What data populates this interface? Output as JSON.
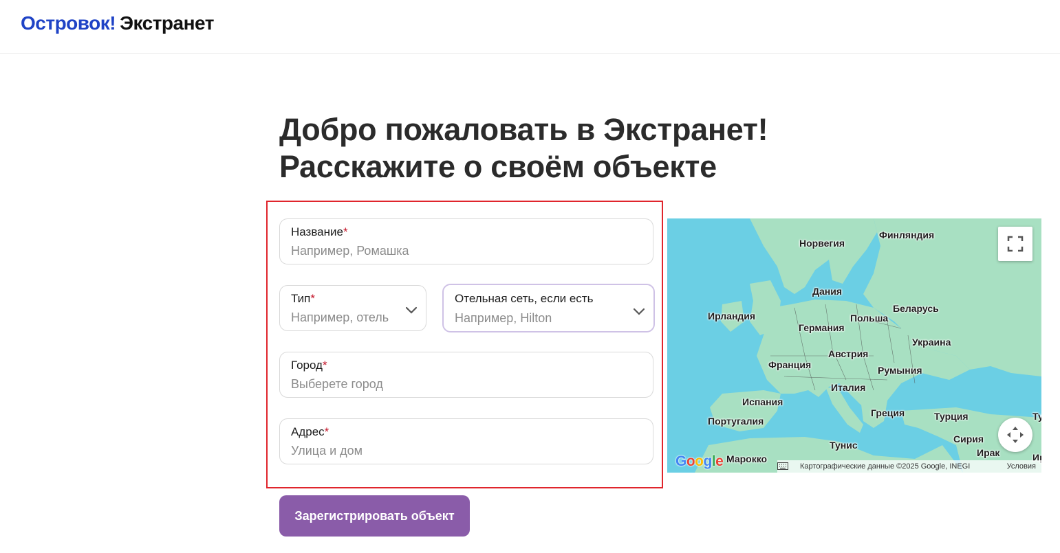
{
  "header": {
    "brand": "Островок!",
    "product": "Экстранет"
  },
  "title": {
    "line1": "Добро пожаловать в Экстранет!",
    "line2": "Расскажите о своём объекте"
  },
  "form": {
    "name": {
      "label": "Название",
      "required": "*",
      "placeholder": "Например, Ромашка"
    },
    "type": {
      "label": "Тип",
      "required": "*",
      "placeholder": "Например, отель"
    },
    "chain": {
      "label": "Отельная сеть, если есть",
      "placeholder": "Например, Hilton"
    },
    "city": {
      "label": "Город",
      "required": "*",
      "placeholder": "Выберете город"
    },
    "address": {
      "label": "Адрес",
      "required": "*",
      "placeholder": "Улица и дом"
    },
    "submit_label": "Зарегистрировать объект"
  },
  "map": {
    "labels": [
      "Норвегия",
      "Финляндия",
      "Дания",
      "Ирландия",
      "Беларусь",
      "Польша",
      "Германия",
      "Украина",
      "Франция",
      "Австрия",
      "Румыния",
      "Италия",
      "Испания",
      "Португалия",
      "Греция",
      "Турция",
      "Сирия",
      "Тунис",
      "Ирак",
      "Марокко",
      "Ту",
      "Ир"
    ],
    "google_logo": "Google",
    "attribution": "Картографические данные ©2025 Google, INEGI",
    "terms": "Условия"
  },
  "colors": {
    "brand_blue": "#1f43c6",
    "submit_purple": "#8a5ca9",
    "required_red": "#c4162a",
    "frame_red": "#e0252c",
    "sea": "#6bcfe4",
    "land": "#a8e0c2"
  }
}
